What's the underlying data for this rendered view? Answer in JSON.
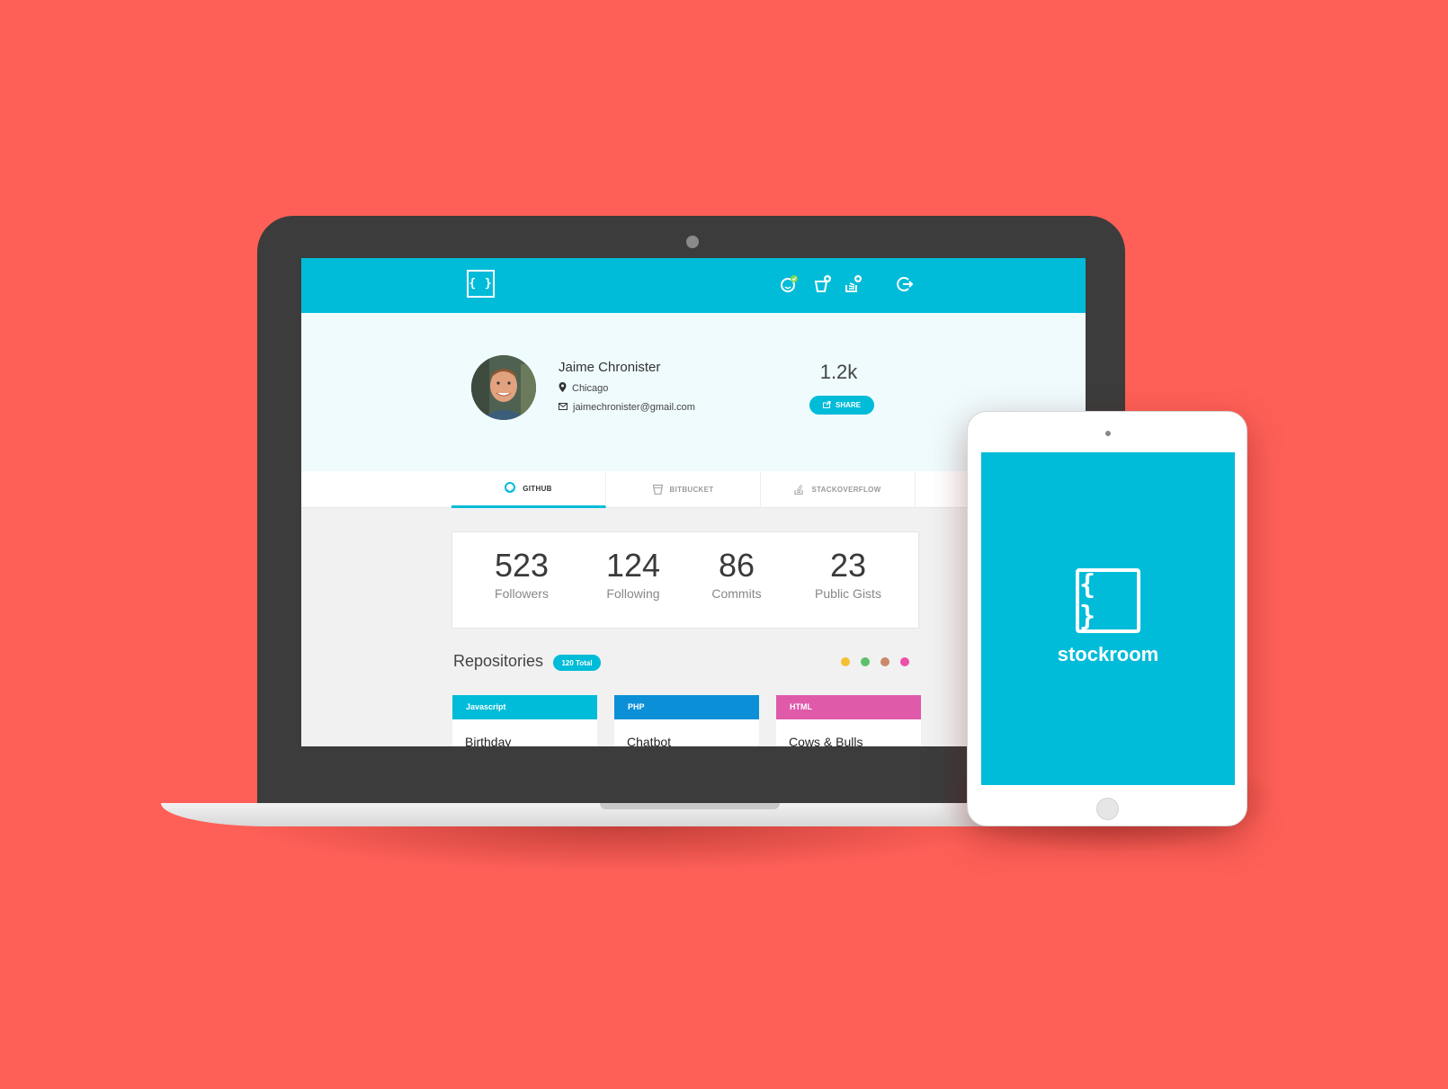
{
  "header": {
    "logo_glyph": "{ }",
    "icons": [
      "github-connected-icon",
      "bitbucket-add-icon",
      "stackoverflow-add-icon",
      "logout-icon"
    ]
  },
  "profile": {
    "name": "Jaime Chronister",
    "location": "Chicago",
    "email": "jaimechronister@gmail.com",
    "score": "1.2k",
    "share_label": "SHARE"
  },
  "tabs": [
    {
      "label": "GITHUB",
      "active": true
    },
    {
      "label": "BITBUCKET",
      "active": false
    },
    {
      "label": "STACKOVERFLOW",
      "active": false
    }
  ],
  "stats": [
    {
      "value": "523",
      "label": "Followers"
    },
    {
      "value": "124",
      "label": "Following"
    },
    {
      "value": "86",
      "label": "Commits"
    },
    {
      "value": "23",
      "label": "Public Gists"
    }
  ],
  "repositories": {
    "title": "Repositories",
    "total_badge": "120 Total",
    "filter_dot_colors": [
      "#f5c033",
      "#5cc06a",
      "#c9896a",
      "#ee4fa8"
    ],
    "items": [
      {
        "language": "Javascript",
        "name": "Birthday",
        "color": "#00bcd8"
      },
      {
        "language": "PHP",
        "name": "Chatbot",
        "color": "#0b8fd6"
      },
      {
        "language": "HTML",
        "name": "Cows & Bulls",
        "color": "#e05aaa"
      }
    ]
  },
  "tablet": {
    "logo_glyph": "{ }",
    "brand": "stockroom"
  },
  "colors": {
    "background": "#fe6057",
    "accent": "#00bcd8"
  }
}
